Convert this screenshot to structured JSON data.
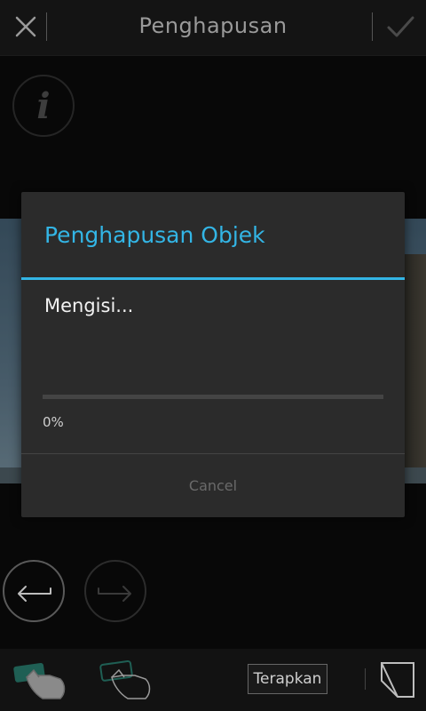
{
  "header": {
    "title": "Penghapusan",
    "close_icon": "close-icon",
    "confirm_icon": "check-icon"
  },
  "info_button": {
    "icon": "info-icon",
    "glyph": "i"
  },
  "dialog": {
    "title": "Penghapusan Objek",
    "message": "Mengisi...",
    "progress_value": 0,
    "progress_label": "0%",
    "cancel_label": "Cancel",
    "accent_color": "#33b5e5"
  },
  "history": {
    "undo_icon": "undo-arrow-icon",
    "redo_icon": "redo-arrow-icon"
  },
  "toolbar": {
    "tool1_icon": "hand-brush-icon",
    "tool2_icon": "hand-eraser-icon",
    "apply_label": "Terapkan",
    "eraser_icon": "eraser-page-icon"
  }
}
